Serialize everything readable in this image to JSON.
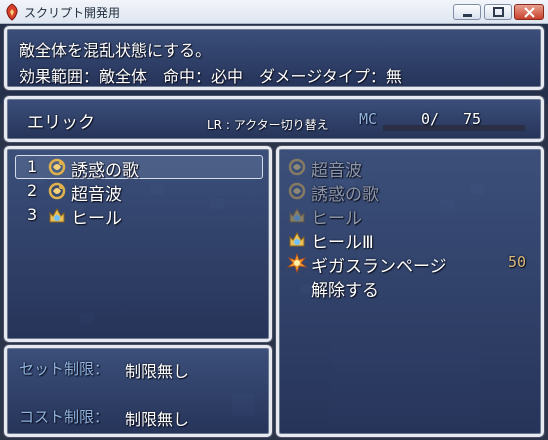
{
  "window": {
    "title": "スクリプト開発用"
  },
  "help": {
    "line1": "敵全体を混乱状態にする。",
    "line2": "効果範囲：敵全体　命中：必中　ダメージタイプ：無"
  },
  "status": {
    "actor_name": "エリック",
    "switch_hint": "LR : アクター切り替え",
    "mc_label": "MC",
    "mc_current": "0/",
    "mc_max": "75",
    "mc_fraction": 0
  },
  "slots": [
    {
      "number": "1",
      "name": "誘惑の歌",
      "icon": "charm-icon"
    },
    {
      "number": "2",
      "name": "超音波",
      "icon": "charm-icon"
    },
    {
      "number": "3",
      "name": "ヒール",
      "icon": "heal-icon"
    }
  ],
  "limits": {
    "set_label": "セット制限：",
    "set_value": "制限無し",
    "cost_label": "コスト制限：",
    "cost_value": "制限無し"
  },
  "skill_list": [
    {
      "name": "超音波",
      "icon": "charm-icon",
      "enabled": false,
      "cost": ""
    },
    {
      "name": "誘惑の歌",
      "icon": "charm-icon",
      "enabled": false,
      "cost": ""
    },
    {
      "name": "ヒール",
      "icon": "heal-icon",
      "enabled": false,
      "cost": ""
    },
    {
      "name": "ヒールⅢ",
      "icon": "heal-icon",
      "enabled": true,
      "cost": ""
    },
    {
      "name": "ギガスランページ",
      "icon": "explosion-icon",
      "enabled": true,
      "cost": "50"
    }
  ],
  "remove_label": "解除する",
  "colors": {
    "system_text": "#8fb3de",
    "cost_text": "#d9b97a",
    "disabled_text": "#8d96a8",
    "mc_gauge": "#b58fd0"
  }
}
